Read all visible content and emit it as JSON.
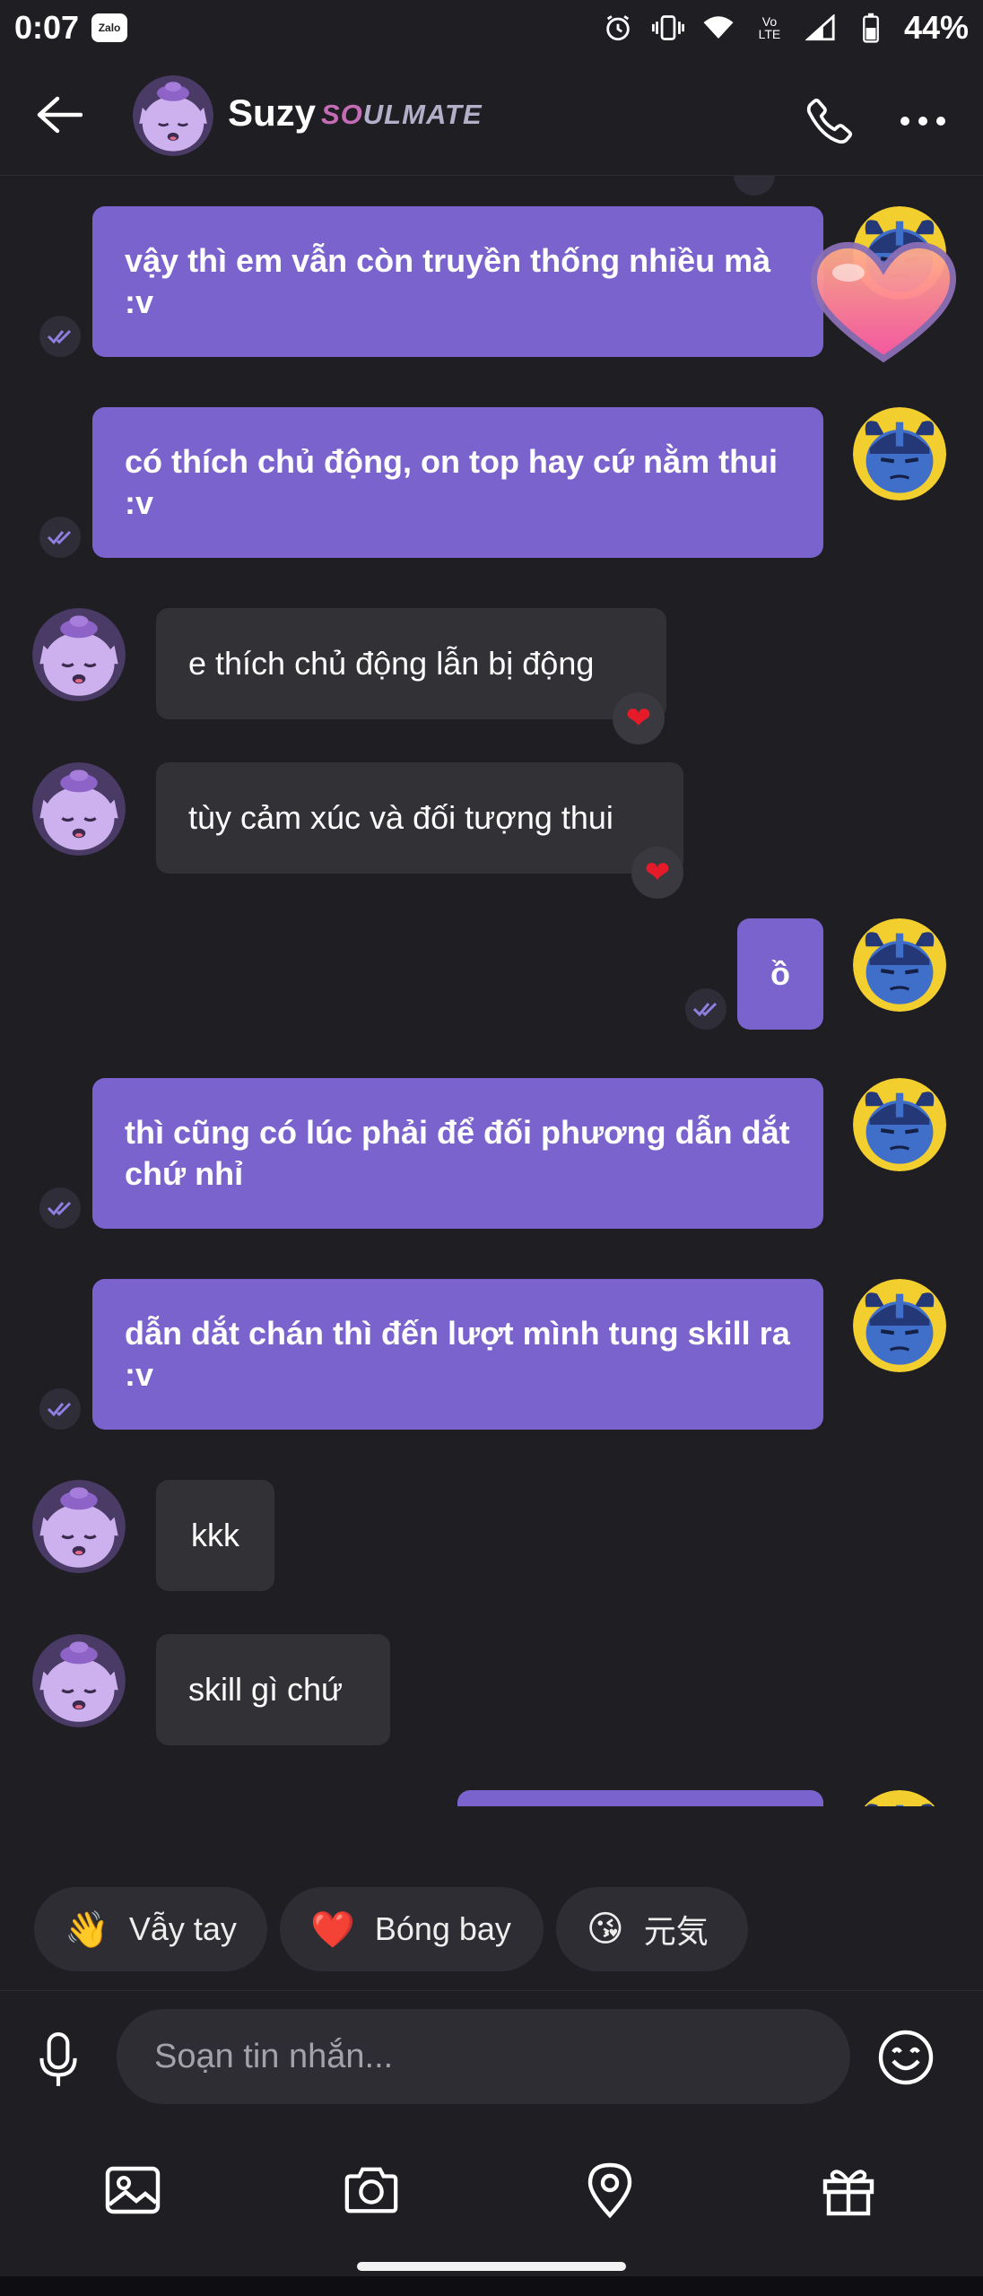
{
  "status_bar": {
    "time": "0:07",
    "zalo_badge": "Zalo",
    "volte": "Vo LTE",
    "battery": "44%"
  },
  "header": {
    "name": "Suzy",
    "badge_so": "SO",
    "badge_rest": "ULMATE"
  },
  "colors": {
    "background": "#1f1e23",
    "outgoing_bubble": "#7a63cc",
    "incoming_bubble": "#323136",
    "accent_pink": "#e27ad0"
  },
  "messages": [
    {
      "dir": "out",
      "text": "vậy thì em vẫn còn truyền thống nhiều mà :v"
    },
    {
      "dir": "out",
      "text": "có thích chủ động, on top hay cứ nằm thui :v"
    },
    {
      "dir": "in",
      "text": "e thích chủ động lẫn bị động",
      "reaction": "❤"
    },
    {
      "dir": "in",
      "text": "tùy cảm xúc và đối tượng thui",
      "reaction": "❤"
    },
    {
      "dir": "out",
      "text": "ồ"
    },
    {
      "dir": "out",
      "text": "thì cũng có lúc phải để đối phương dẫn dắt chứ nhỉ"
    },
    {
      "dir": "out",
      "text": "dẫn dắt chán thì đến lượt mình tung skill ra :v"
    },
    {
      "dir": "in",
      "text": "kkk"
    },
    {
      "dir": "in",
      "text": "skill gì chứ"
    }
  ],
  "quick_reactions": [
    {
      "emoji": "👋",
      "label": "Vẫy tay"
    },
    {
      "emoji": "❤️",
      "label": "Bóng bay"
    },
    {
      "emoji": "😘",
      "label": "元気"
    }
  ],
  "composer": {
    "placeholder": "Soạn tin nhắn..."
  },
  "icons": {
    "back": "arrow-left-icon",
    "call": "phone-icon",
    "more": "more-horizontal-icon",
    "mic": "microphone-icon",
    "emoji": "emoji-icon",
    "image": "image-icon",
    "camera": "camera-icon",
    "location": "location-pin-icon",
    "gift": "gift-icon"
  }
}
